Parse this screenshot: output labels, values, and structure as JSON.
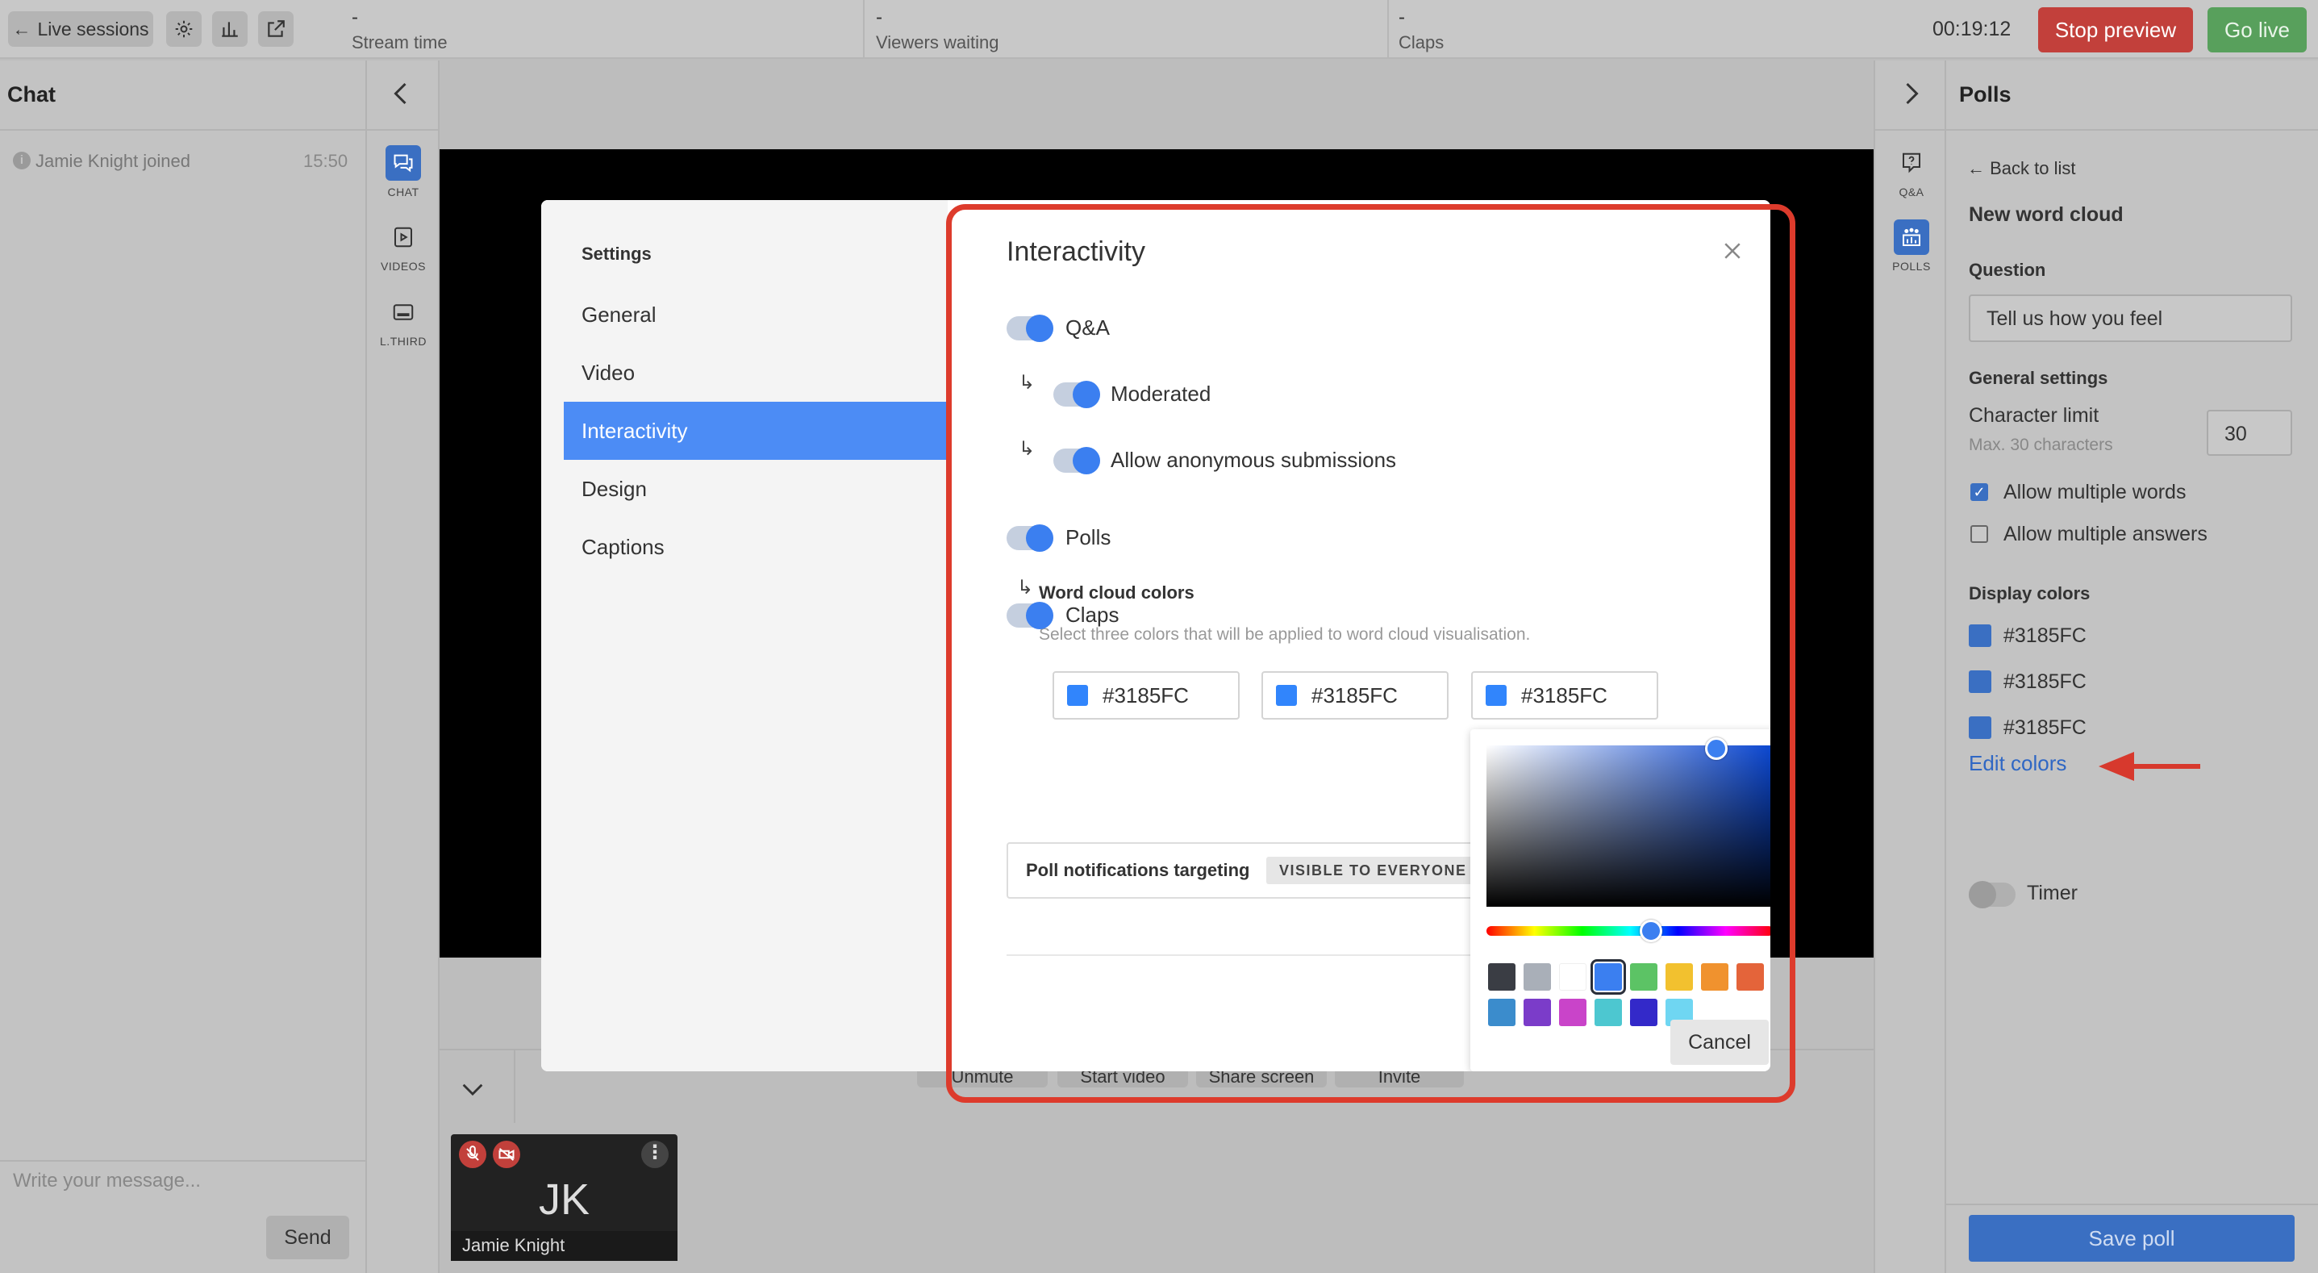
{
  "topbar": {
    "back_label": "Live sessions",
    "stats": [
      {
        "value": "-",
        "label": "Stream time"
      },
      {
        "value": "-",
        "label": "Viewers waiting"
      },
      {
        "value": "-",
        "label": "Claps"
      }
    ],
    "timer": "00:19:12",
    "stop_preview": "Stop preview",
    "go_live": "Go live"
  },
  "chat": {
    "title": "Chat",
    "messages": [
      {
        "text": "Jamie Knight joined",
        "time": "15:50"
      }
    ],
    "input_placeholder": "Write your message...",
    "send_label": "Send"
  },
  "left_rail": {
    "items": [
      {
        "label": "CHAT",
        "icon": "chat-icon"
      },
      {
        "label": "VIDEOS",
        "icon": "video-icon"
      },
      {
        "label": "L.THIRD",
        "icon": "lower-third-icon"
      }
    ]
  },
  "right_rail": {
    "items": [
      {
        "label": "Q&A",
        "icon": "question-icon"
      },
      {
        "label": "POLLS",
        "icon": "polls-icon"
      }
    ]
  },
  "controls": {
    "labels": [
      "Unmute",
      "Start video",
      "Share screen",
      "Invite"
    ]
  },
  "tile": {
    "initials": "JK",
    "name": "Jamie Knight"
  },
  "polls": {
    "title": "Polls",
    "back_label": "Back to list",
    "heading": "New word cloud",
    "question_label": "Question",
    "question_value": "Tell us how you feel",
    "general_settings": "General settings",
    "char_limit_label": "Character limit",
    "char_limit_hint": "Max. 30 characters",
    "char_limit_value": "30",
    "allow_multiple_words": "Allow multiple words",
    "allow_multiple_answers": "Allow multiple answers",
    "display_colors_label": "Display colors",
    "colors": [
      "#3185FC",
      "#3185FC",
      "#3185FC"
    ],
    "edit_colors": "Edit colors",
    "timer_label": "Timer",
    "save_label": "Save poll"
  },
  "modal": {
    "settings_title": "Settings",
    "nav": [
      "General",
      "Video",
      "Interactivity",
      "Design",
      "Captions"
    ],
    "active_nav": "Interactivity",
    "title": "Interactivity",
    "qa_label": "Q&A",
    "moderated_label": "Moderated",
    "anon_label": "Allow anonymous submissions",
    "polls_label": "Polls",
    "word_cloud_label": "Word cloud colors",
    "word_cloud_hint": "Select three colors that will be applied to word cloud visualisation.",
    "color_fields": [
      "#3185FC",
      "#3185FC",
      "#3185FC"
    ],
    "claps_label": "Claps",
    "notif_label": "Poll notifications targeting",
    "notif_badge": "VISIBLE TO EVERYONE"
  },
  "picker": {
    "cancel_label": "Cancel",
    "palette_row1": [
      "#3a3d44",
      "#a9afb8",
      "#ffffff",
      "#3b7ff0",
      "#5cc365",
      "#f2c12f",
      "#f0922e",
      "#e4643a"
    ],
    "palette_row2": [
      "#3b8ccc",
      "#7b3cc9",
      "#c944c9",
      "#4dc7d0",
      "#3329c9",
      "#6fd6f2"
    ]
  },
  "colors": {
    "accent": "#3185FC",
    "highlight_frame": "#DD3B2C",
    "stop": "#C2403B",
    "live": "#58A05C"
  }
}
